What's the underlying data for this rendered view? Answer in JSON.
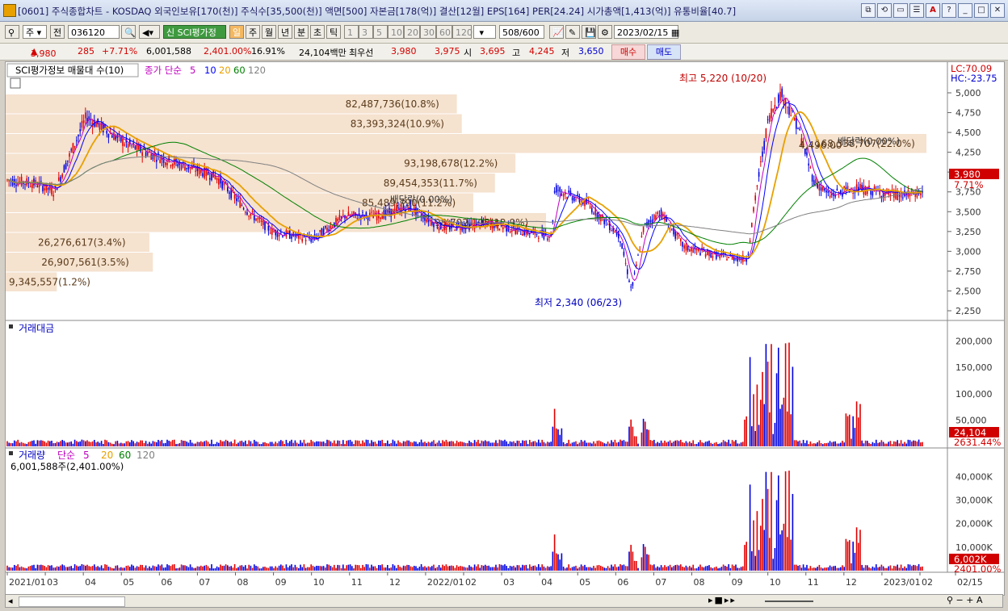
{
  "window": {
    "title": "[0601] 주식종합차트 - KOSDAQ 외국인보유[170(천)] 주식수[35,500(천)] 액면[500] 자본금[178(억)] 결산[12월] EPS[164] PER[24.24] 시가총액[1,413(억)] 유통비율[40.7]",
    "buttons": [
      "⧉",
      "⟲",
      "▭",
      "☰",
      "A",
      "?",
      "_",
      "□",
      "✕"
    ]
  },
  "toolbar": {
    "period_sel": "주",
    "prev_label": "전",
    "code": "036120",
    "sci_label": "SCI평가정",
    "day_label": "일",
    "week_label": "주",
    "month_label": "월",
    "year_label": "년",
    "minute_label": "분",
    "sec_label": "초",
    "tick_label": "틱",
    "intervals": [
      "1",
      "3",
      "5",
      "10",
      "20",
      "30",
      "60",
      "120"
    ],
    "count": "508",
    "count_total": "/600",
    "date": "2023/02/15"
  },
  "quote": {
    "price": "3,980",
    "change": "285",
    "change_pct": "+7.71%",
    "volume": "6,001,588",
    "vol_pct": "2,401.00%",
    "turnover": "16.91%",
    "amount": "24,104백만",
    "best_label": "최우선",
    "ask": "3,980",
    "bid": "3,975",
    "open_label": "시",
    "open": "3,695",
    "high_label": "고",
    "high": "4,245",
    "low_label": "저",
    "low": "3,650",
    "buy_label": "매수",
    "sell_label": "매도"
  },
  "price_panel": {
    "legend_title": "SCI평가정보 매물대 수(10)",
    "ma_label": "종가 단순",
    "ma_periods": [
      "5",
      "10",
      "20",
      "60",
      "120"
    ],
    "ma_colors": [
      "#c000c0",
      "#0000ff",
      "#e8a000",
      "#008000",
      "#808080"
    ],
    "lc": "LC:70.09",
    "hc": "HC:-23.75",
    "high_note": "최고 5,220 (10/20)",
    "low_note": "최저 2,340 (06/23)",
    "dividend_note": "배당락(0.00%)",
    "dividend_note2": "배당락(0.00%)",
    "current_price": "3,980",
    "current_pct": "7.71%",
    "y_ticks": [
      "5,000",
      "4,750",
      "4,500",
      "4,250",
      "4,000",
      "3,750",
      "3,500",
      "3,250",
      "3,000",
      "2,750",
      "2,500",
      "2,250"
    ],
    "volume_profile": [
      {
        "label": "82,487,736(10.8%)",
        "value": 82487736
      },
      {
        "label": "83,393,324(10.9%)",
        "value": 83393324
      },
      {
        "label": "168,338,707(22.0%)",
        "value": 168338707
      },
      {
        "label": "93,198,678(12.2%)",
        "value": 93198678
      },
      {
        "label": "89,454,353(11.7%)",
        "value": 89454353
      },
      {
        "label": "85,489,790(11.2%)",
        "value": 85489790
      },
      {
        "label": "98,792,195(12.9%)",
        "value": 98792195
      },
      {
        "label": "26,276,617(3.4%)",
        "value": 26276617
      },
      {
        "label": "26,907,561(3.5%)",
        "value": 26907561
      },
      {
        "label": "9,345,557(1.2%)",
        "value": 9345557
      }
    ],
    "extra_label": "4,496.00"
  },
  "amount_panel": {
    "title": "거래대금",
    "y_ticks": [
      "200,000",
      "150,000",
      "100,000",
      "50,000"
    ],
    "current": "24,104",
    "current_pct": "2631.44%"
  },
  "volume_panel": {
    "title": "거래량",
    "ma_label": "단순",
    "ma_periods": [
      "5",
      "20",
      "60",
      "120"
    ],
    "info": "6,001,588주(2,401.00%)",
    "y_ticks": [
      "40,000K",
      "30,000K",
      "20,000K",
      "10,000K"
    ],
    "current": "6,002K",
    "current_pct": "2401.00%"
  },
  "x_axis": [
    "2021/01",
    "03",
    "04",
    "05",
    "06",
    "07",
    "08",
    "09",
    "10",
    "11",
    "12",
    "2022/01",
    "02",
    "03",
    "04",
    "05",
    "06",
    "07",
    "08",
    "09",
    "10",
    "11",
    "12",
    "2023/01",
    "02",
    "02/15"
  ]
}
